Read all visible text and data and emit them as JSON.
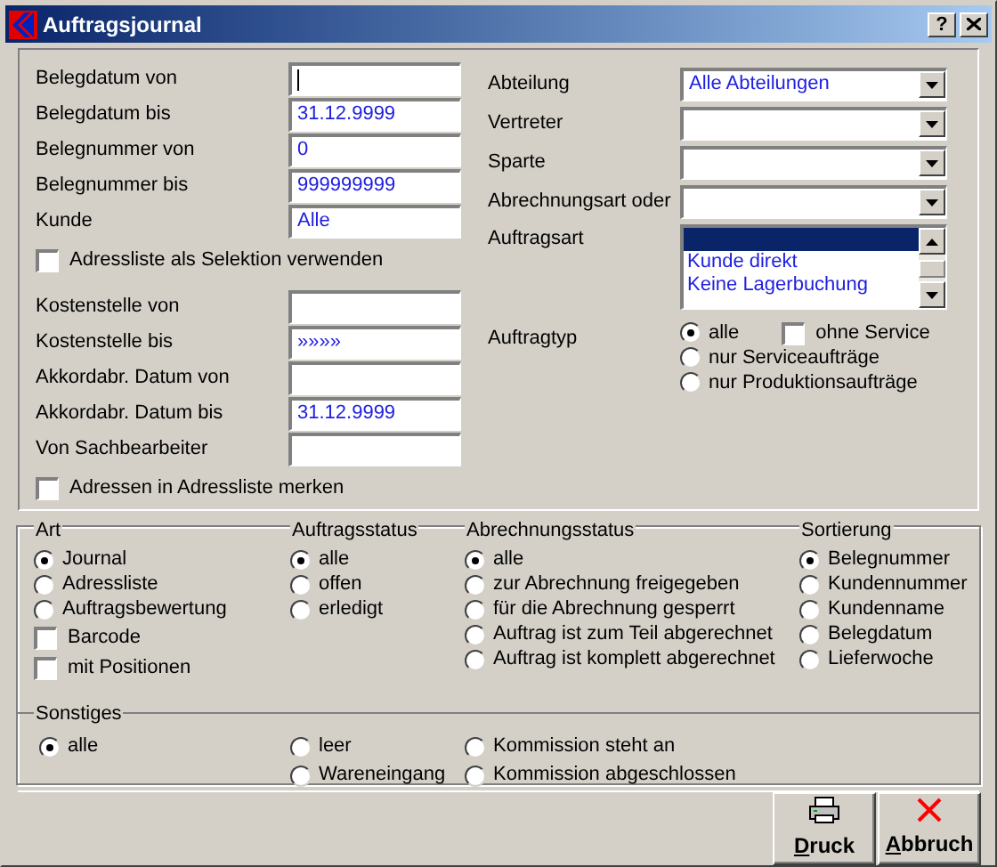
{
  "window": {
    "title": "Auftragsjournal"
  },
  "help_button": {
    "label": "?"
  },
  "left_filters": [
    {
      "kind": "field",
      "label": "Belegdatum von",
      "focused": true
    },
    {
      "kind": "field",
      "label": "Belegdatum bis",
      "value": "31.12.9999",
      "focused": false
    },
    {
      "kind": "field",
      "label": "Belegnummer von",
      "value": "0",
      "focused": false
    },
    {
      "kind": "field",
      "label": "Belegnummer bis",
      "value": "999999999",
      "focused": false
    },
    {
      "kind": "field",
      "label": "Kunde",
      "value": "Alle",
      "focused": false
    },
    {
      "kind": "checkbox",
      "label": "Adressliste als Selektion verwenden",
      "checked": false
    },
    {
      "kind": "field",
      "label": "Kostenstelle von",
      "focused": false
    },
    {
      "kind": "field",
      "label": "Kostenstelle bis",
      "value": "»»»»",
      "focused": false
    },
    {
      "kind": "field",
      "label": "Akkordabr. Datum von",
      "focused": false
    },
    {
      "kind": "field",
      "label": "Akkordabr. Datum bis",
      "value": "31.12.9999",
      "focused": false
    },
    {
      "kind": "field",
      "label": "Von Sachbearbeiter",
      "focused": false
    },
    {
      "kind": "checkbox",
      "label": "Adressen in Adressliste merken",
      "checked": false
    }
  ],
  "right_filters": [
    {
      "kind": "combo",
      "label": "Abteilung",
      "value": "Alle Abteilungen"
    },
    {
      "kind": "combo",
      "label": "Vertreter"
    },
    {
      "kind": "combo",
      "label": "Sparte"
    },
    {
      "kind": "combo",
      "label": "Abrechnungsart oder"
    },
    {
      "kind": "list",
      "label": "Auftragsart",
      "items": [
        {
          "selected": true
        },
        {
          "label": "Kunde direkt",
          "selected": false
        },
        {
          "label": "Keine Lagerbuchung",
          "selected": false
        }
      ]
    },
    {
      "kind": "radio",
      "label": "Auftragtyp",
      "options": [
        {
          "label": "alle",
          "selected": true
        },
        {
          "label": "nur Serviceaufträge",
          "selected": false
        },
        {
          "label": "nur Produktionsaufträge",
          "selected": false
        }
      ],
      "extra": {
        "label": "ohne Service",
        "checked": false
      }
    }
  ],
  "groups": [
    {
      "title": "Art",
      "items": [
        {
          "kind": "radio",
          "label": "Journal",
          "selected": true
        },
        {
          "kind": "radio",
          "label": "Adressliste",
          "selected": false
        },
        {
          "kind": "radio",
          "label": "Auftragsbewertung",
          "selected": false
        },
        {
          "kind": "checkbox",
          "label": "Barcode",
          "checked": false
        },
        {
          "kind": "checkbox",
          "label": "mit Positionen",
          "checked": false
        }
      ]
    },
    {
      "title": "Auftragsstatus",
      "items": [
        {
          "kind": "radio",
          "label": "alle",
          "selected": true
        },
        {
          "kind": "radio",
          "label": "offen",
          "selected": false
        },
        {
          "kind": "radio",
          "label": "erledigt",
          "selected": false
        }
      ]
    },
    {
      "title": "Abrechnungsstatus",
      "items": [
        {
          "kind": "radio",
          "label": "alle",
          "selected": true
        },
        {
          "kind": "radio",
          "label": "zur Abrechnung freigegeben",
          "selected": false
        },
        {
          "kind": "radio",
          "label": "für die Abrechnung gesperrt",
          "selected": false
        },
        {
          "kind": "radio",
          "label": "Auftrag ist zum Teil abgerechnet",
          "selected": false
        },
        {
          "kind": "radio",
          "label": "Auftrag ist komplett abgerechnet",
          "selected": false
        }
      ]
    },
    {
      "title": "Sortierung",
      "items": [
        {
          "kind": "radio",
          "label": "Belegnummer",
          "selected": true
        },
        {
          "kind": "radio",
          "label": "Kundennummer",
          "selected": false
        },
        {
          "kind": "radio",
          "label": "Kundenname",
          "selected": false
        },
        {
          "kind": "radio",
          "label": "Belegdatum",
          "selected": false
        },
        {
          "kind": "radio",
          "label": "Lieferwoche",
          "selected": false
        }
      ]
    }
  ],
  "sonstiges": {
    "title": "Sonstiges",
    "columns": [
      [
        {
          "label": "alle",
          "selected": true
        }
      ],
      [
        {
          "label": "leer",
          "selected": false
        },
        {
          "label": "Wareneingang",
          "selected": false
        }
      ],
      [
        {
          "label": "Kommission steht an",
          "selected": false
        },
        {
          "label": "Kommission abgeschlossen",
          "selected": false
        }
      ]
    ]
  },
  "buttons": [
    {
      "kind": "print",
      "label": "Druck"
    },
    {
      "kind": "cancel",
      "label": "Abbruch"
    }
  ]
}
